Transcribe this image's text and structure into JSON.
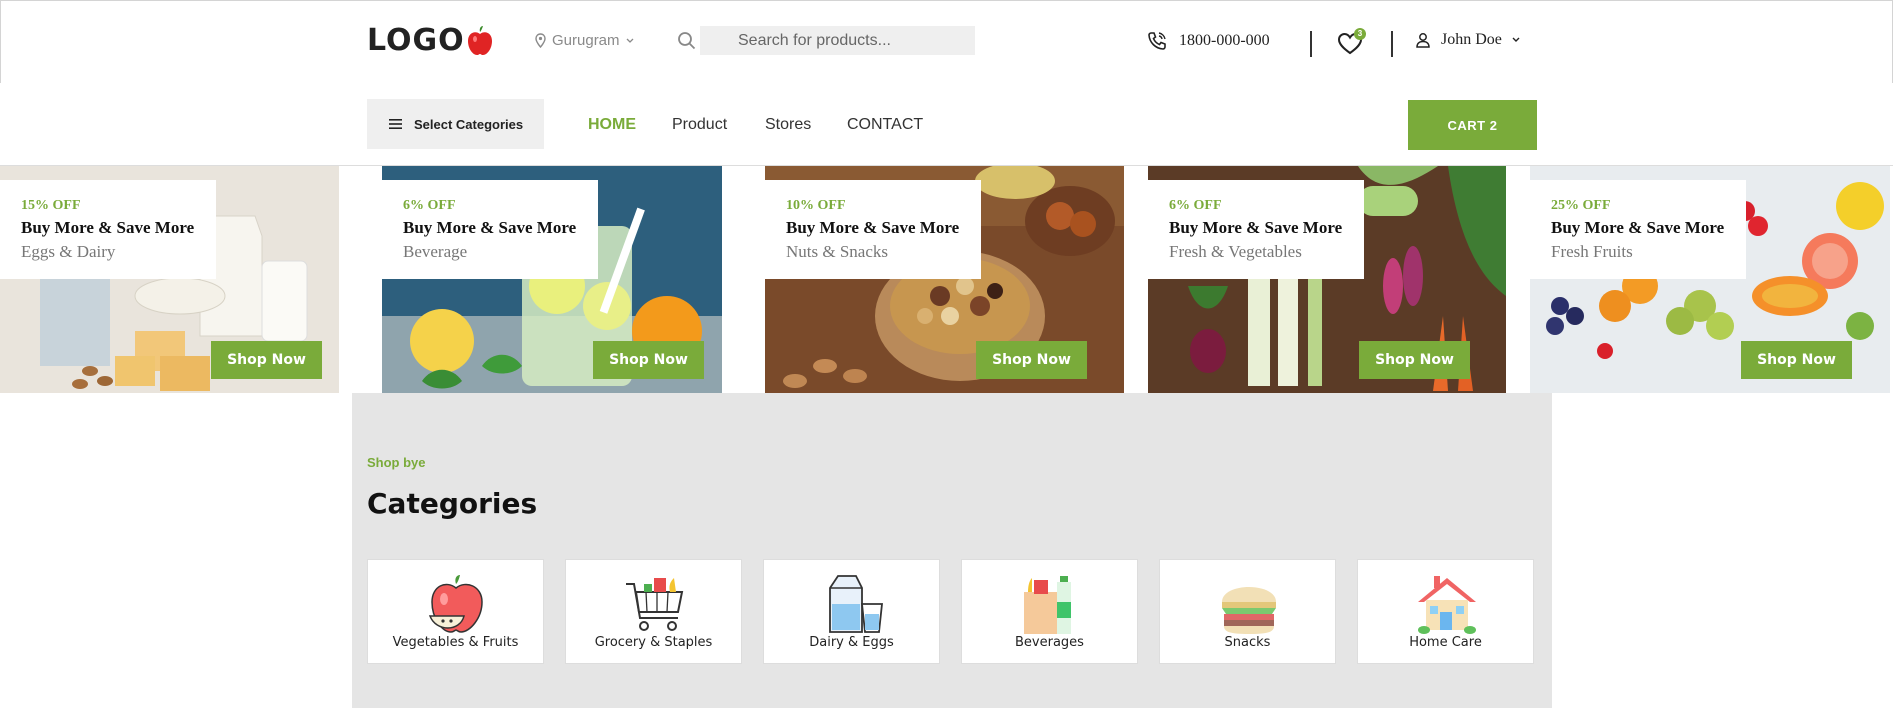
{
  "header": {
    "logo_text": "LOGO",
    "location": "Gurugram",
    "search_placeholder": "Search for products...",
    "phone": "1800-000-000",
    "wishlist_count": "3",
    "user_name": "John Doe"
  },
  "nav": {
    "select_categories": "Select Categories",
    "links": [
      "HOME",
      "Product",
      "Stores",
      "CONTACT"
    ],
    "cart_label": "CART 2"
  },
  "promos": [
    {
      "off": "15% OFF",
      "headline": "Buy More & Save More",
      "sub": "Eggs & Dairy",
      "cta": "Shop Now"
    },
    {
      "off": "6% OFF",
      "headline": "Buy More & Save More",
      "sub": "Beverage",
      "cta": "Shop Now"
    },
    {
      "off": "10% OFF",
      "headline": "Buy More & Save More",
      "sub": "Nuts & Snacks",
      "cta": "Shop Now"
    },
    {
      "off": "6% OFF",
      "headline": "Buy More & Save More",
      "sub": "Fresh & Vegetables",
      "cta": "Shop Now"
    },
    {
      "off": "25% OFF",
      "headline": "Buy More & Save More",
      "sub": "Fresh Fruits",
      "cta": "Shop Now"
    }
  ],
  "categories_section": {
    "eyebrow": "Shop bye",
    "title": "Categories",
    "items": [
      {
        "label": "Vegetables & Fruits",
        "icon": "apple-icon"
      },
      {
        "label": "Grocery & Staples",
        "icon": "shopping-cart-icon"
      },
      {
        "label": "Dairy & Eggs",
        "icon": "milk-carton-icon"
      },
      {
        "label": "Beverages",
        "icon": "bottles-icon"
      },
      {
        "label": "Snacks",
        "icon": "burger-icon"
      },
      {
        "label": "Home Care",
        "icon": "house-icon"
      }
    ]
  },
  "colors": {
    "accent": "#7aab3a",
    "section_bg": "#e5e5e5",
    "search_bg": "#efefef"
  }
}
